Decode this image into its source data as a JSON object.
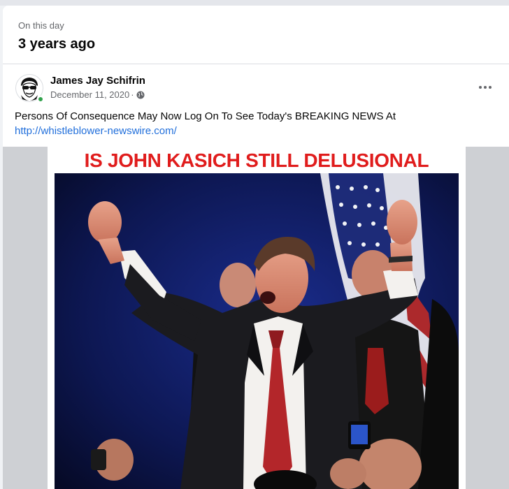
{
  "memory": {
    "kicker": "On this day",
    "title": "3 years ago"
  },
  "post": {
    "author": "James Jay Schifrin",
    "date": "December 11, 2020",
    "separator": "·",
    "privacy_icon": "globe-icon",
    "more_icon": "more-options-icon",
    "text": "Persons Of Consequence May Now Log On To See Today's BREAKING NEWS At",
    "link": "http://whistleblower-newswire.com/"
  },
  "image": {
    "caption": "IS JOHN KASICH STILL DELUSIONAL",
    "subject": "man in dark suit and red tie raising both fists in front of an American flag"
  },
  "colors": {
    "link": "#216fdb",
    "caption": "#e01c1c",
    "online": "#31a24c",
    "muted": "#65676b"
  }
}
